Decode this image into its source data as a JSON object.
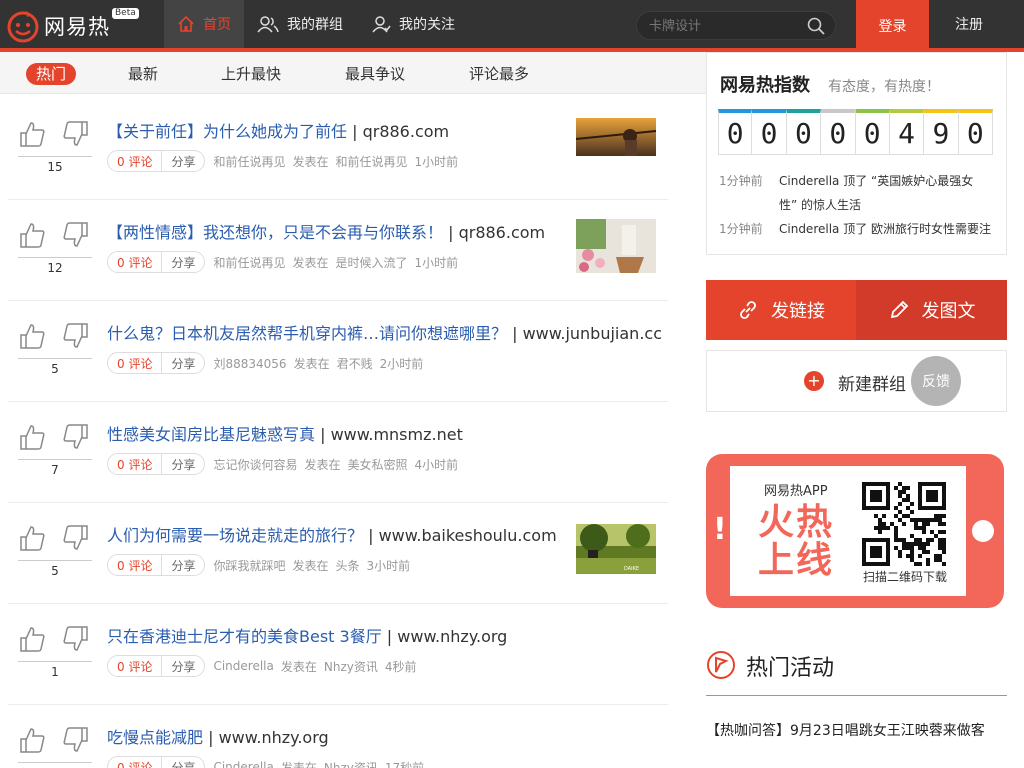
{
  "header": {
    "logo_text": "网易热",
    "beta_badge": "Beta",
    "nav": [
      {
        "label": "首页",
        "icon": "home-icon",
        "active": true
      },
      {
        "label": "我的群组",
        "icon": "group-icon",
        "active": false
      },
      {
        "label": "我的关注",
        "icon": "follow-icon",
        "active": false
      }
    ],
    "search_placeholder": "卡牌设计",
    "login_label": "登录",
    "register_label": "注册"
  },
  "tabs": [
    {
      "label": "热门",
      "active": true
    },
    {
      "label": "最新",
      "active": false
    },
    {
      "label": "上升最快",
      "active": false
    },
    {
      "label": "最具争议",
      "active": false
    },
    {
      "label": "评论最多",
      "active": false
    }
  ],
  "feed": [
    {
      "title": "【关于前任】为什么她成为了前任",
      "source": " | qr886.com",
      "votes": "15",
      "comments": "0 评论",
      "share": "分享",
      "author": "和前任说再见",
      "posted_in_label": "发表在",
      "group": "和前任说再见",
      "time": "1小时前",
      "thumb": "sunset"
    },
    {
      "title": "【两性情感】我还想你，只是不会再与你联系！",
      "source": " | qr886.com",
      "votes": "12",
      "comments": "0 评论",
      "share": "分享",
      "author": "和前任说再见",
      "posted_in_label": "发表在",
      "group": "是时候入流了",
      "time": "1小时前",
      "thumb": "flowers"
    },
    {
      "title": "什么鬼？日本机友居然帮手机穿内裤…请问你想遮哪里？",
      "source": " | www.junbujian.cc",
      "votes": "5",
      "comments": "0 评论",
      "share": "分享",
      "author": "刘88834056",
      "posted_in_label": "发表在",
      "group": "君不贱",
      "time": "2小时前",
      "thumb": null
    },
    {
      "title": "性感美女闺房比基尼魅惑写真",
      "source": " | www.mnsmz.net",
      "votes": "7",
      "comments": "0 评论",
      "share": "分享",
      "author": "忘记你谈何容易",
      "posted_in_label": "发表在",
      "group": "美女私密照",
      "time": "4小时前",
      "thumb": null
    },
    {
      "title": "人们为何需要一场说走就走的旅行？",
      "source": " | www.baikeshoulu.com",
      "votes": "5",
      "comments": "0 评论",
      "share": "分享",
      "author": "你踩我就踩吧",
      "posted_in_label": "发表在",
      "group": "头条",
      "time": "3小时前",
      "thumb": "forest"
    },
    {
      "title": "只在香港迪士尼才有的美食Best 3餐厅",
      "source": " | www.nhzy.org",
      "votes": "1",
      "comments": "0 评论",
      "share": "分享",
      "author": "Cinderella",
      "posted_in_label": "发表在",
      "group": "Nhzy资讯",
      "time": "4秒前",
      "thumb": null
    },
    {
      "title": "吃慢点能减肥",
      "source": " | www.nhzy.org",
      "votes": "",
      "comments": "0 评论",
      "share": "分享",
      "author": "Cinderella",
      "posted_in_label": "发表在",
      "group": "Nhzy资讯",
      "time": "17秒前",
      "thumb": null
    }
  ],
  "hot_index": {
    "title": "网易热指数",
    "subtitle": "有态度，有热度！",
    "digits": [
      "0",
      "0",
      "0",
      "0",
      "0",
      "4",
      "9",
      "0"
    ],
    "digit_colors": [
      "#1e9bd8",
      "#1e9bd8",
      "#1aa3a0",
      "#c8c8c8",
      "#8bc34a",
      "#b5c93a",
      "#f0c419",
      "#f0c419"
    ],
    "activity": [
      {
        "when": "1分钟前",
        "what": "Cinderella 顶了 “英国嫉妒心最强女性” 的惊人生活"
      },
      {
        "when": "1分钟前",
        "what": "Cinderella 顶了 欧洲旅行时女性需要注"
      }
    ]
  },
  "actions": {
    "post_link": "发链接",
    "post_image": "发图文",
    "new_group": "新建群组",
    "feedback": "反馈"
  },
  "app_banner": {
    "app_name": "网易热APP",
    "slogan": "火热上线",
    "qr_caption": "扫描二维码下载"
  },
  "hot_events": {
    "title": "热门活动",
    "items": [
      "【热咖问答】9月23日唱跳女王江映蓉来做客"
    ]
  },
  "colors": {
    "brand": "#e5442c",
    "topbar": "#333333",
    "link": "#2a5db0",
    "banner": "#f3675a"
  }
}
